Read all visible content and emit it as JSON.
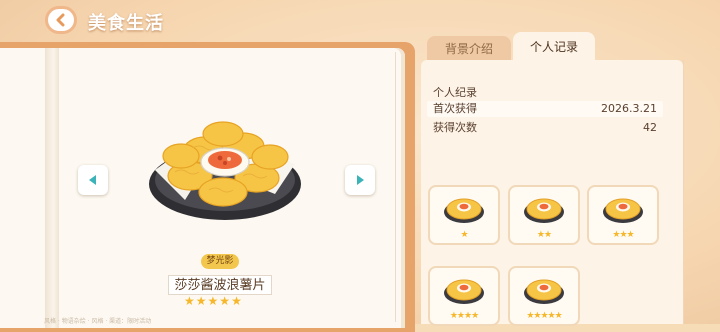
{
  "header": {
    "title": "美食生活"
  },
  "book": {
    "series_tag": "梦光影",
    "item_name": "莎莎酱波浪薯片",
    "stars": 5,
    "stars_text": "★★★★★",
    "footer_note": "风格 · 物语杂烩 · 风格 · 渠道：限时活动"
  },
  "tabs": [
    {
      "label": "背景介绍",
      "active": false
    },
    {
      "label": "个人记录",
      "active": true
    }
  ],
  "record": {
    "heading": "个人纪录",
    "rows": [
      {
        "label": "首次获得",
        "value": "2026.3.21"
      },
      {
        "label": "获得次数",
        "value": "42"
      }
    ]
  },
  "variants": [
    {
      "stars": 1,
      "stars_text": "★"
    },
    {
      "stars": 2,
      "stars_text": "★★"
    },
    {
      "stars": 3,
      "stars_text": "★★★"
    },
    {
      "stars": 4,
      "stars_text": "★★★★"
    },
    {
      "stars": 5,
      "stars_text": "★★★★★"
    }
  ],
  "colors": {
    "accent": "#f3c74e",
    "star": "#f6b72a",
    "panel": "#fdf3e6",
    "title": "#ffffff"
  }
}
